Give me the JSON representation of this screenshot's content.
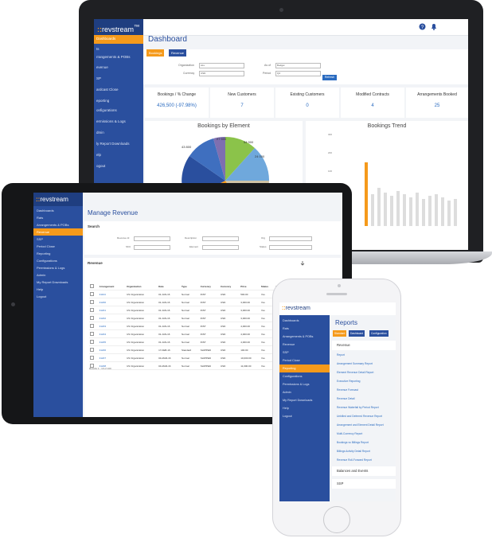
{
  "colors": {
    "brand_blue": "#2a4f9e",
    "brand_orange": "#f59a1b",
    "link_blue": "#2a6bc0"
  },
  "laptop": {
    "logo_prefix": "::",
    "logo_name": "revstream",
    "logo_tm": "™",
    "sidebar": [
      "Dashboards",
      "ts",
      "rrangements & POBs",
      "evenue",
      "SP",
      "ardcast Close",
      "eporting",
      "onfigurations",
      "ermissions & Logs",
      "dmin",
      "ly Report Downloads",
      "elp",
      "ogout"
    ],
    "page_title": "Dashboard",
    "tabs": [
      "Bookings",
      "Revenue"
    ],
    "filters": [
      {
        "label": "Organization",
        "value": "ALL"
      },
      {
        "label": "Currency",
        "value": "USD"
      },
      {
        "label": "As of",
        "value": "Budget"
      },
      {
        "label": "Period",
        "value": "Q4"
      }
    ],
    "search_label": "Refresh",
    "kpis": [
      {
        "title": "Bookings / % Change",
        "value": "426,500 (-97.98%)"
      },
      {
        "title": "New Customers",
        "value": "7"
      },
      {
        "title": "Existing Customers",
        "value": "0"
      },
      {
        "title": "Modified Contracts",
        "value": "4"
      },
      {
        "title": "Arrangements Booked",
        "value": "25"
      }
    ],
    "pie_title": "Bookings by Element",
    "pie_labels": [
      "27 500",
      "54 900",
      "43 800",
      "24 000"
    ],
    "trend_title": "Bookings Trend",
    "trend_ticks": [
      "300",
      "200",
      "100"
    ]
  },
  "tablet": {
    "logo_prefix": "::",
    "logo_name": "revstream",
    "sidebar": [
      "Dashboards",
      "Rats",
      "Arrangements & POBs",
      "Revenue",
      "SSP",
      "Period Close",
      "Reporting",
      "Configurations",
      "Permissions & Logs",
      "Admin",
      "My Report Downloads",
      "Help",
      "Logout"
    ],
    "active_index": 3,
    "page_title": "Manage Revenue",
    "search_title": "Search",
    "search_fields": [
      "Revenue Id",
      "SKU",
      "Description",
      "Element",
      "Org",
      "Status"
    ],
    "revenue_title": "Revenue",
    "table_headers": [
      "",
      "Arrangement",
      "Organization",
      "Date",
      "Type",
      "Currency",
      "Currency",
      "Price",
      "Status",
      "Deferred Rev",
      "Recognized Rev"
    ],
    "table_rows": [
      [
        "31104",
        "US Organization",
        "01-JAN-16",
        "Normal",
        "INST",
        "USD",
        "500.00",
        "Yes"
      ],
      [
        "31200",
        "US Organization",
        "01-JAN-16",
        "Normal",
        "INST",
        "USD",
        "3,000.00",
        "Yes"
      ],
      [
        "31201",
        "US Organization",
        "01-JAN-16",
        "Normal",
        "INST",
        "USD",
        "3,000.00",
        "Yes"
      ],
      [
        "31202",
        "US Organization",
        "01-JAN-16",
        "Normal",
        "INST",
        "USD",
        "3,000.00",
        "Yes"
      ],
      [
        "31203",
        "US Organization",
        "01-JAN-16",
        "Normal",
        "INST",
        "USD",
        "4,000.00",
        "Yes"
      ],
      [
        "31204",
        "US Organization",
        "01-JAN-16",
        "Normal",
        "INST",
        "USD",
        "4,000.00",
        "Yes"
      ],
      [
        "31205",
        "US Organization",
        "01-JAN-16",
        "Normal",
        "INST",
        "USD",
        "4,000.00",
        "Yes"
      ],
      [
        "31206",
        "US Organization",
        "17-FEB-16",
        "Standard",
        "SHIPPED",
        "USD",
        "100.00",
        "Yes"
      ],
      [
        "31207",
        "US Organization",
        "04-MAR-16",
        "Normal",
        "SHIPPED",
        "USD",
        "10,000.00",
        "Yes"
      ],
      [
        "31208",
        "US Organization",
        "04-MAR-16",
        "Normal",
        "SHIPPED",
        "USD",
        "11,000.00",
        "Yes"
      ]
    ],
    "table_footer": "Results 1 - 10 of 100"
  },
  "phone": {
    "logo_prefix": "::",
    "logo_name": "revstream",
    "sidebar": [
      "Dashboards",
      "Rats",
      "Arrangements & POBs",
      "Revenue",
      "SSP",
      "Period Close",
      "Reporting",
      "Configurations",
      "Permissions & Logs",
      "Admin",
      "My Report Downloads",
      "Help",
      "Logout"
    ],
    "active_index": 6,
    "page_title": "Reports",
    "tabs": [
      "Standard",
      "Dashboard",
      "Configuration"
    ],
    "section_revenue": "Revenue",
    "report_links": [
      "Report",
      "Arrangement Summary Report",
      "Element Revenue Detail Report",
      "Executive Reporting",
      "Revenue Forecast",
      "Revenue Detail",
      "Revenue Waterfall by Period Report",
      "Unbilled and Deferred Revenue Report",
      "Arrangement and Element Detail Report",
      "Multi-Currency Report",
      "Bookings vs Billings Report",
      "Billings Activity Detail Report",
      "Revenue Roll-Forward Report"
    ],
    "section_balances": "Balances and Events",
    "section_ssp": "SSP"
  }
}
